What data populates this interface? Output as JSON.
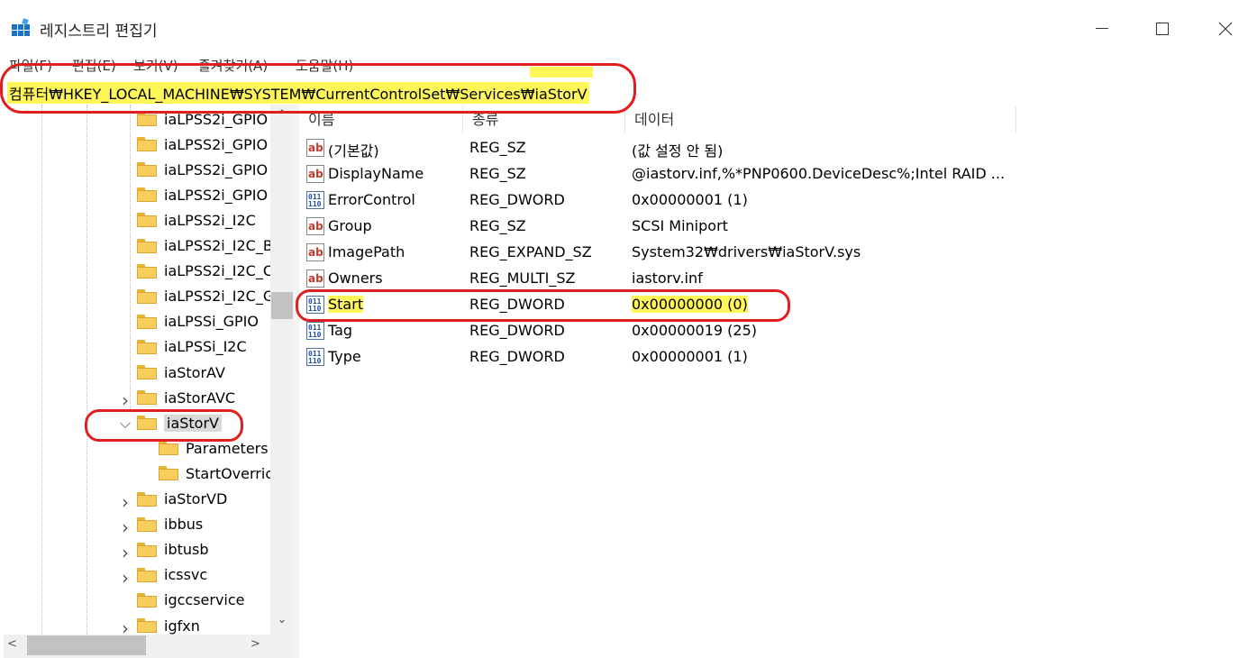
{
  "window": {
    "title": "레지스트리 편집기"
  },
  "menu": [
    "파일(F)",
    "편집(E)",
    "보기(V)",
    "즐겨찾기(A)",
    "도움말(H)"
  ],
  "address": "컴퓨터₩HKEY_LOCAL_MACHINE₩SYSTEM₩CurrentControlSet₩Services₩iaStorV",
  "tree": [
    {
      "label": "iaLPSS2i_GPIO",
      "level": 0,
      "expander": "",
      "selected": false
    },
    {
      "label": "iaLPSS2i_GPIO",
      "level": 0,
      "expander": "",
      "selected": false
    },
    {
      "label": "iaLPSS2i_GPIO",
      "level": 0,
      "expander": "",
      "selected": false
    },
    {
      "label": "iaLPSS2i_GPIO",
      "level": 0,
      "expander": "",
      "selected": false
    },
    {
      "label": "iaLPSS2i_I2C",
      "level": 0,
      "expander": "",
      "selected": false
    },
    {
      "label": "iaLPSS2i_I2C_B",
      "level": 0,
      "expander": "",
      "selected": false
    },
    {
      "label": "iaLPSS2i_I2C_C",
      "level": 0,
      "expander": "",
      "selected": false
    },
    {
      "label": "iaLPSS2i_I2C_G",
      "level": 0,
      "expander": "",
      "selected": false
    },
    {
      "label": "iaLPSSi_GPIO",
      "level": 0,
      "expander": "",
      "selected": false
    },
    {
      "label": "iaLPSSi_I2C",
      "level": 0,
      "expander": "",
      "selected": false
    },
    {
      "label": "iaStorAV",
      "level": 0,
      "expander": "",
      "selected": false
    },
    {
      "label": "iaStorAVC",
      "level": 0,
      "expander": ">",
      "selected": false
    },
    {
      "label": "iaStorV",
      "level": 0,
      "expander": "v",
      "selected": true
    },
    {
      "label": "Parameters",
      "level": 1,
      "expander": "",
      "selected": false
    },
    {
      "label": "StartOverric",
      "level": 1,
      "expander": "",
      "selected": false
    },
    {
      "label": "iaStorVD",
      "level": 0,
      "expander": ">",
      "selected": false
    },
    {
      "label": "ibbus",
      "level": 0,
      "expander": ">",
      "selected": false
    },
    {
      "label": "ibtusb",
      "level": 0,
      "expander": ">",
      "selected": false
    },
    {
      "label": "icssvc",
      "level": 0,
      "expander": ">",
      "selected": false
    },
    {
      "label": "igccservice",
      "level": 0,
      "expander": "",
      "selected": false
    },
    {
      "label": "igfxn",
      "level": 0,
      "expander": ">",
      "selected": false
    }
  ],
  "columns": {
    "name": "이름",
    "type": "종류",
    "data": "데이터"
  },
  "values": [
    {
      "name": "(기본값)",
      "type": "REG_SZ",
      "data": "(값 설정 안 됨)",
      "icon": "ab"
    },
    {
      "name": "DisplayName",
      "type": "REG_SZ",
      "data": "@iastorv.inf,%*PNP0600.DeviceDesc%;Intel RAID ...",
      "icon": "ab"
    },
    {
      "name": "ErrorControl",
      "type": "REG_DWORD",
      "data": "0x00000001 (1)",
      "icon": "bin"
    },
    {
      "name": "Group",
      "type": "REG_SZ",
      "data": "SCSI Miniport",
      "icon": "ab"
    },
    {
      "name": "ImagePath",
      "type": "REG_EXPAND_SZ",
      "data": "System32₩drivers₩iaStorV.sys",
      "icon": "ab"
    },
    {
      "name": "Owners",
      "type": "REG_MULTI_SZ",
      "data": "iastorv.inf",
      "icon": "ab"
    },
    {
      "name": "Start",
      "type": "REG_DWORD",
      "data": "0x00000000 (0)",
      "icon": "bin"
    },
    {
      "name": "Tag",
      "type": "REG_DWORD",
      "data": "0x00000019 (25)",
      "icon": "bin"
    },
    {
      "name": "Type",
      "type": "REG_DWORD",
      "data": "0x00000001 (1)",
      "icon": "bin"
    }
  ],
  "colors": {
    "annotation_red": "#e02020",
    "highlight_yellow": "#fff65a",
    "folder": "#f7cd5b"
  }
}
